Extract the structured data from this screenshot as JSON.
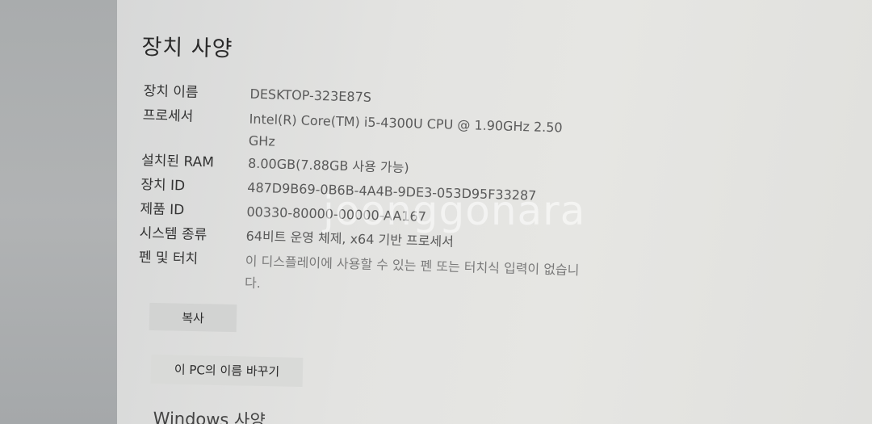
{
  "section_title": "장치 사양",
  "specs": [
    {
      "label": "장치 이름",
      "value": "DESKTOP-323E87S"
    },
    {
      "label": "프로세서",
      "value": "Intel(R) Core(TM) i5-4300U CPU @ 1.90GHz   2.50 GHz"
    },
    {
      "label": "설치된 RAM",
      "value": "8.00GB(7.88GB 사용 가능)"
    },
    {
      "label": "장치 ID",
      "value": "487D9B69-0B6B-4A4B-9DE3-053D95F33287"
    },
    {
      "label": "제품 ID",
      "value": "00330-80000-00000-AA167"
    },
    {
      "label": "시스템 종류",
      "value": "64비트 운영 체제, x64 기반 프로세서"
    },
    {
      "label": "펜 및 터치",
      "value": "이 디스플레이에 사용할 수 있는 펜 또는 터치식 입력이 없습니다."
    }
  ],
  "buttons": {
    "copy": "복사",
    "rename": "이 PC의 이름 바꾸기"
  },
  "next_section_title": "Windows 사양",
  "watermark": "joonggonara"
}
